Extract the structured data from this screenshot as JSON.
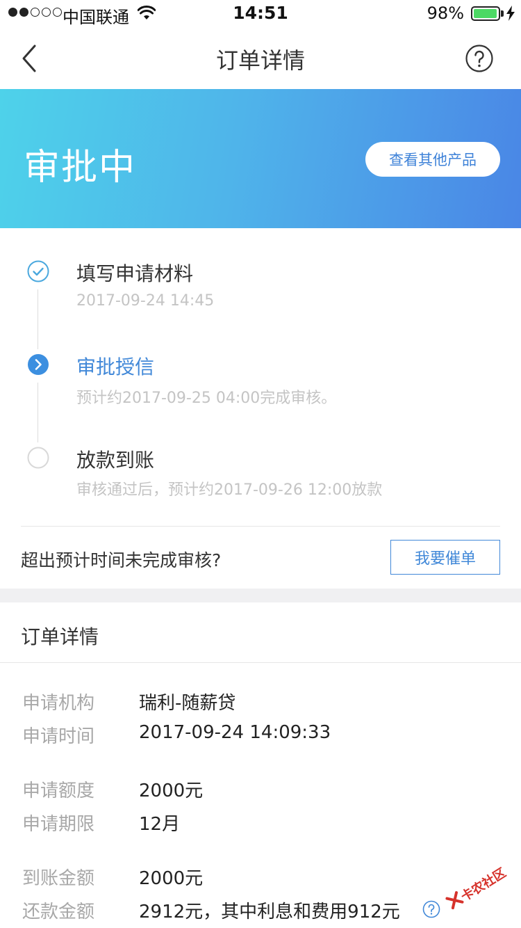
{
  "status_bar": {
    "carrier": "中国联通",
    "time": "14:51",
    "battery": "98%",
    "signal_dots_on": 2,
    "signal_dots_total": 5,
    "battery_level": 0.98
  },
  "nav": {
    "title": "订单详情",
    "back_icon": "chevron-left-icon",
    "help_icon": "question-circle-icon"
  },
  "banner": {
    "status": "审批中",
    "button_label": "查看其他产品",
    "gradient_start": "#4ed2ea",
    "gradient_end": "#4a86e6"
  },
  "timeline": {
    "steps": [
      {
        "title": "填写申请材料",
        "subtitle": "2017-09-24 14:45",
        "state": "done",
        "icon": "check-circle-icon"
      },
      {
        "title": "审批授信",
        "subtitle": "预计约2017-09-25 04:00完成审核。",
        "state": "active",
        "icon": "chevron-right-circle-icon"
      },
      {
        "title": "放款到账",
        "subtitle": "审核通过后，预计约2017-09-26 12:00放款",
        "state": "pending",
        "icon": "empty-circle-icon"
      }
    ],
    "overdue_question": "超出预计时间未完成审核?",
    "urge_button": "我要催单"
  },
  "details": {
    "title": "订单详情",
    "rows": [
      {
        "label": "申请机构",
        "value": "瑞利-随薪贷"
      },
      {
        "label": "申请时间",
        "value": "2017-09-24 14:09:33"
      },
      {
        "label": "申请额度",
        "value": "2000元"
      },
      {
        "label": "申请期限",
        "value": "12月"
      },
      {
        "label": "到账金额",
        "value": "2000元"
      },
      {
        "label": "还款金额",
        "value": "2912元，其中利息和费用912元"
      }
    ]
  },
  "watermark": {
    "text": "卡农社区"
  },
  "colors": {
    "accent": "#4188d8",
    "muted_text": "#c4c4c4",
    "label_text": "#a8a8a8",
    "battery_green": "#4cd964"
  }
}
